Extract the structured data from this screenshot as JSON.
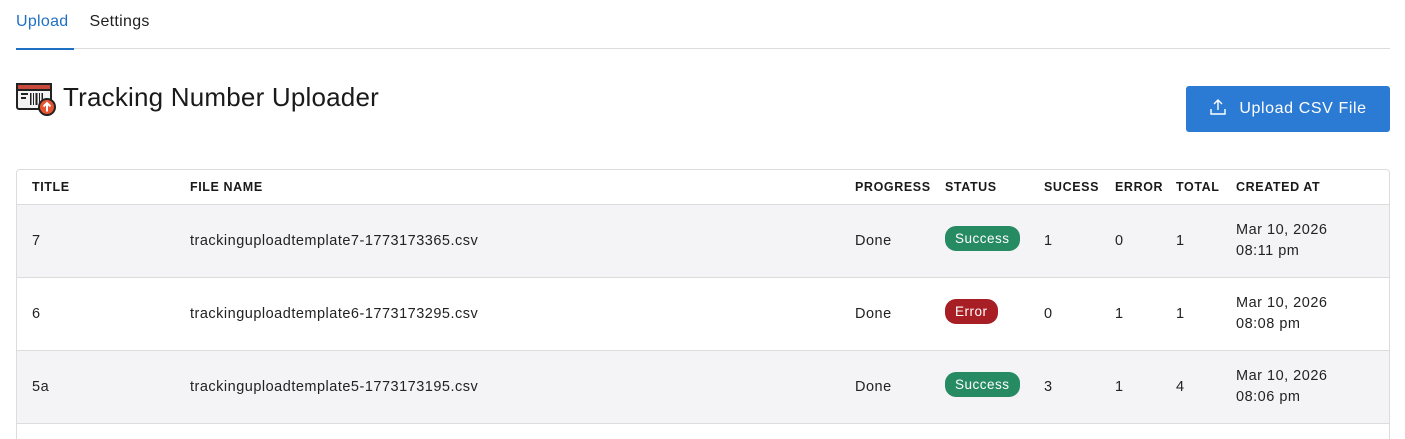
{
  "tabs": [
    {
      "label": "Upload",
      "active": true
    },
    {
      "label": "Settings",
      "active": false
    }
  ],
  "header": {
    "title": "Tracking Number Uploader",
    "icon": "barcode-upload-icon",
    "upload_button_label": "Upload CSV File"
  },
  "table": {
    "columns": [
      "TITLE",
      "FILE NAME",
      "PROGRESS",
      "STATUS",
      "SUCESS",
      "ERROR",
      "TOTAL",
      "CREATED AT"
    ],
    "rows": [
      {
        "title": "7",
        "file_name": "trackinguploadtemplate7-1773173365.csv",
        "progress": "Done",
        "status": "Success",
        "success": "1",
        "error": "0",
        "total": "1",
        "created_date": "Mar 10, 2026",
        "created_time": "08:11 pm"
      },
      {
        "title": "6",
        "file_name": "trackinguploadtemplate6-1773173295.csv",
        "progress": "Done",
        "status": "Error",
        "success": "0",
        "error": "1",
        "total": "1",
        "created_date": "Mar 10, 2026",
        "created_time": "08:08 pm"
      },
      {
        "title": "5a",
        "file_name": "trackinguploadtemplate5-1773173195.csv",
        "progress": "Done",
        "status": "Success",
        "success": "3",
        "error": "1",
        "total": "4",
        "created_date": "Mar 10, 2026",
        "created_time": "08:06 pm"
      }
    ]
  },
  "colors": {
    "accent": "#2b7bd4",
    "success_badge": "#268a63",
    "error_badge": "#a81e25"
  }
}
